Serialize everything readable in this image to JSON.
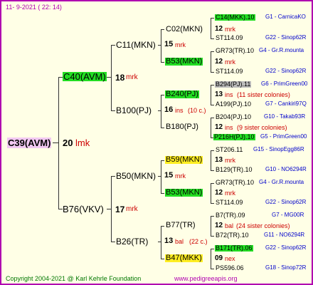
{
  "header": {
    "date": "11-  9-2021 ( 22:  14)"
  },
  "footer": {
    "copyright": "Copyright 2004-2021 @ Karl Kehrle Foundation",
    "site": "www.pedigreeapis.org"
  },
  "colors": {
    "frame": "#b000b0",
    "background": "#ffffe6",
    "green_highlight": "#22dd22",
    "yellow_highlight": "#ffee22",
    "grey_highlight": "#bbbbbb",
    "red_text": "#cc0000",
    "blue_text": "#0000cc"
  },
  "gen0": {
    "name": "C39(AVM)",
    "num": "20",
    "abbr": "lmk"
  },
  "gen1": [
    {
      "name": "C40(AVM)",
      "num": "18",
      "abbr": "mrk"
    },
    {
      "name": "B76(VKV)",
      "num": "17",
      "abbr": "mrk"
    }
  ],
  "gen2": [
    {
      "name": "C11(MKN)",
      "num": "15",
      "abbr": "mrk"
    },
    {
      "name": "B100(PJ)",
      "num": "16",
      "abbr": "ins",
      "note": "(10 c.)"
    },
    {
      "name": "B50(MKN)",
      "num": "15",
      "abbr": "mrk"
    },
    {
      "name": "B26(TR)",
      "num": "13",
      "abbr": "bal",
      "note": "(22 c.)"
    }
  ],
  "gen3": [
    {
      "name": "C02(MKN)",
      "num": "12",
      "abbr": "mrk"
    },
    {
      "name": "B53(MKN)",
      "num": "12",
      "abbr": "mrk"
    },
    {
      "name": "B240(PJ)",
      "num": "13",
      "abbr": "ins",
      "note": "(11 sister colonies)"
    },
    {
      "name": "B180(PJ)",
      "num": "12",
      "abbr": "ins",
      "note": "(9 sister colonies)"
    },
    {
      "name": "B59(MKN)",
      "num": "13",
      "abbr": "mrk"
    },
    {
      "name": "B53(MKN)",
      "num": "12",
      "abbr": "mrk"
    },
    {
      "name": "B77(TR)",
      "num": "12",
      "abbr": "bal",
      "note": "(24 sister colonies)"
    },
    {
      "name": "B47(MKK)",
      "num": "09",
      "abbr": "nex"
    }
  ],
  "gen4": [
    {
      "name": "C14(MKK).10",
      "code": "G1 - CarnicaKO"
    },
    {
      "name": "ST114.09",
      "code": "G22 - Sinop62R"
    },
    {
      "name": "GR73(TR).10",
      "code": "G4 - Gr.R.mounta"
    },
    {
      "name": "ST114.09",
      "code": "G22 - Sinop62R"
    },
    {
      "name": "B294(PJ).11",
      "code": "G6 - PrimGreen00"
    },
    {
      "name": "A199(PJ).10",
      "code": "G7 - Cankiri97Q"
    },
    {
      "name": "B204(PJ).10",
      "code": "G10 - Takab93R"
    },
    {
      "name": "P216H(PJ).10",
      "code": "G5 - PrimGreen00"
    },
    {
      "name": "ST206.11",
      "code": "G15 - SinopEgg86R"
    },
    {
      "name": "B129(TR).10",
      "code": "G10 - NO6294R"
    },
    {
      "name": "GR73(TR).10",
      "code": "G4 - Gr.R.mounta"
    },
    {
      "name": "ST114.09",
      "code": "G22 - Sinop62R"
    },
    {
      "name": "B7(TR).09",
      "code": "G7 - MG00R"
    },
    {
      "name": "B72(TR).10",
      "code": "G11 - NO6294R"
    },
    {
      "name": "B171(TR).06",
      "code": "G22 - Sinop62R"
    },
    {
      "name": "PS596.06",
      "code": "G18 - Sinop72R"
    }
  ]
}
